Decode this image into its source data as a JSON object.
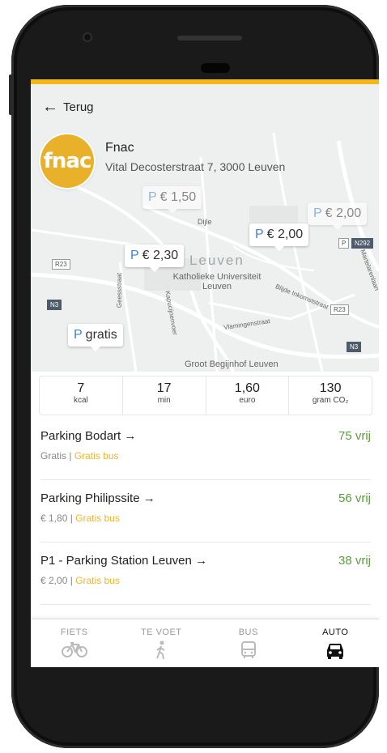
{
  "header": {
    "back_label": "Terug"
  },
  "store": {
    "logo_text": "fnac",
    "name": "Fnac",
    "address": "Vital Decosterstraat 7, 3000 Leuven"
  },
  "map": {
    "pins": [
      {
        "p": "P",
        "price": "€ 1,50"
      },
      {
        "p": "P",
        "price": "€ 2,00"
      },
      {
        "p": "P",
        "price": "€ 2,00"
      },
      {
        "p": "P",
        "price": "€ 2,30"
      },
      {
        "p": "P",
        "price": "gratis"
      }
    ],
    "labels": {
      "city": "Leuven",
      "university": "Katholieke Universiteit Leuven",
      "begijnhof": "Groot Begijnhof Leuven",
      "dijle": "Dijle",
      "vlamingen": "Vlamingenstraat",
      "inkomst": "Blijde Inkomststraat",
      "geesstraat": "Geessstraat",
      "kapucijnen": "Kapucijnenvoer",
      "martelaren": "Martelarenlaan",
      "r23a": "R23",
      "r23b": "R23",
      "n3a": "N3",
      "n3b": "N3",
      "n292": "N292",
      "p_icon": "P"
    }
  },
  "stats": [
    {
      "value": "7",
      "unit": "kcal"
    },
    {
      "value": "17",
      "unit": "min"
    },
    {
      "value": "1,60",
      "unit": "euro"
    },
    {
      "value": "130",
      "unit": "gram CO₂"
    }
  ],
  "parkings": [
    {
      "name": "Parking Bodart →",
      "price": "Gratis",
      "sep": " | ",
      "bus": "Gratis bus",
      "free": "75 vrij"
    },
    {
      "name": "Parking Philipssite →",
      "price": "€ 1,80",
      "sep": " | ",
      "bus": "Gratis bus",
      "free": "56 vrij"
    },
    {
      "name": "P1 - Parking Station Leuven →",
      "price": "€ 2,00",
      "sep": " | ",
      "bus": "Gratis bus",
      "free": "38 vrij"
    }
  ],
  "nav": [
    {
      "label": "FIETS",
      "icon": "bike-icon"
    },
    {
      "label": "TE VOET",
      "icon": "walk-icon"
    },
    {
      "label": "BUS",
      "icon": "bus-icon"
    },
    {
      "label": "AUTO",
      "icon": "car-icon"
    }
  ],
  "colors": {
    "accent": "#f2b71a",
    "parking_p": "#3b86d4",
    "free_green": "#5a9e3a",
    "bus_orange": "#f0b42a"
  }
}
